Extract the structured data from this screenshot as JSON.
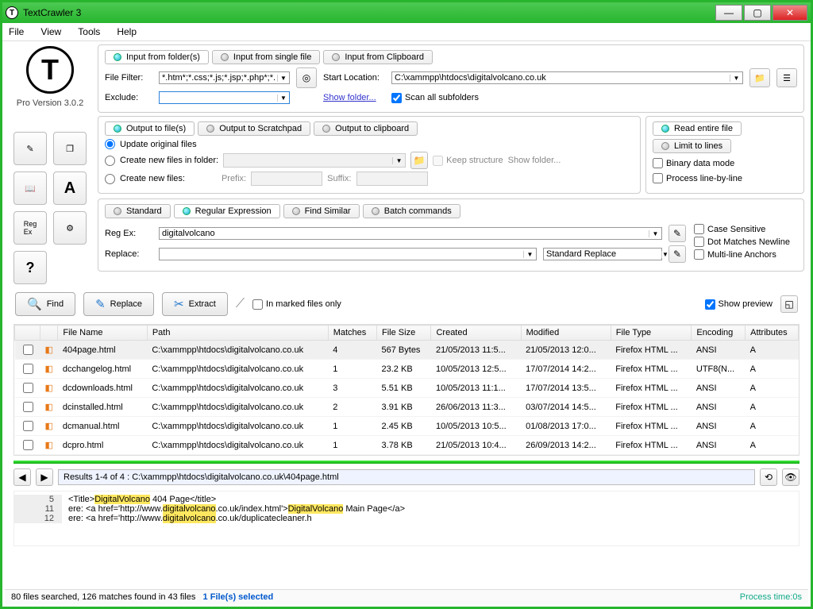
{
  "titlebar": {
    "title": "TextCrawler 3"
  },
  "menubar": {
    "file": "File",
    "view": "View",
    "tools": "Tools",
    "help": "Help"
  },
  "sidebar": {
    "version": "Pro Version 3.0.2",
    "regex": "Reg\nEx"
  },
  "input": {
    "tabs": {
      "folders": "Input from folder(s)",
      "single": "Input from single file",
      "clipboard": "Input from Clipboard"
    },
    "file_filter_label": "File Filter:",
    "file_filter_value": "*.htm*;*.css;*.js;*.jsp;*.php*;*.asp",
    "start_location_label": "Start Location:",
    "start_location_value": "C:\\xammpp\\htdocs\\digitalvolcano.co.uk",
    "exclude_label": "Exclude:",
    "exclude_value": "",
    "show_folder": "Show folder...",
    "scan_subfolders": "Scan all subfolders"
  },
  "output": {
    "tabs": {
      "files": "Output to file(s)",
      "scratch": "Output to Scratchpad",
      "clipboard": "Output to clipboard"
    },
    "update_original": "Update original files",
    "create_in_folder": "Create new files in folder:",
    "keep_structure": "Keep structure",
    "show_folder": "Show folder...",
    "create_new": "Create new files:",
    "prefix": "Prefix:",
    "suffix": "Suffix:"
  },
  "read": {
    "tabs": {
      "entire": "Read entire file",
      "limit": "Limit to lines"
    },
    "binary": "Binary data mode",
    "line": "Process line-by-line"
  },
  "search": {
    "tabs": {
      "standard": "Standard",
      "regex": "Regular Expression",
      "similar": "Find Similar",
      "batch": "Batch commands"
    },
    "regex_label": "Reg Ex:",
    "regex_value": "digitalvolcano",
    "replace_label": "Replace:",
    "replace_mode": "Standard Replace",
    "case_sensitive": "Case Sensitive",
    "dot_newline": "Dot Matches Newline",
    "multi_anchors": "Multi-line Anchors"
  },
  "actions": {
    "find": "Find",
    "replace": "Replace",
    "extract": "Extract",
    "marked": "In marked files only",
    "preview": "Show preview"
  },
  "table": {
    "headers": {
      "fname": "File Name",
      "path": "Path",
      "matches": "Matches",
      "fsize": "File Size",
      "created": "Created",
      "modified": "Modified",
      "ftype": "File Type",
      "enc": "Encoding",
      "attr": "Attributes"
    },
    "rows": [
      {
        "fname": "404page.html",
        "path": "C:\\xammpp\\htdocs\\digitalvolcano.co.uk",
        "matches": "4",
        "fsize": "567 Bytes",
        "created": "21/05/2013 11:5...",
        "modified": "21/05/2013 12:0...",
        "ftype": "Firefox HTML ...",
        "enc": "ANSI",
        "attr": "A"
      },
      {
        "fname": "dcchangelog.html",
        "path": "C:\\xammpp\\htdocs\\digitalvolcano.co.uk",
        "matches": "1",
        "fsize": "23.2 KB",
        "created": "10/05/2013 12:5...",
        "modified": "17/07/2014 14:2...",
        "ftype": "Firefox HTML ...",
        "enc": "UTF8(N...",
        "attr": "A"
      },
      {
        "fname": "dcdownloads.html",
        "path": "C:\\xammpp\\htdocs\\digitalvolcano.co.uk",
        "matches": "3",
        "fsize": "5.51 KB",
        "created": "10/05/2013 11:1...",
        "modified": "17/07/2014 13:5...",
        "ftype": "Firefox HTML ...",
        "enc": "ANSI",
        "attr": "A"
      },
      {
        "fname": "dcinstalled.html",
        "path": "C:\\xammpp\\htdocs\\digitalvolcano.co.uk",
        "matches": "2",
        "fsize": "3.91 KB",
        "created": "26/06/2013 11:3...",
        "modified": "03/07/2014 14:5...",
        "ftype": "Firefox HTML ...",
        "enc": "ANSI",
        "attr": "A"
      },
      {
        "fname": "dcmanual.html",
        "path": "C:\\xammpp\\htdocs\\digitalvolcano.co.uk",
        "matches": "1",
        "fsize": "2.45 KB",
        "created": "10/05/2013 10:5...",
        "modified": "01/08/2013 17:0...",
        "ftype": "Firefox HTML ...",
        "enc": "ANSI",
        "attr": "A"
      },
      {
        "fname": "dcpro.html",
        "path": "C:\\xammpp\\htdocs\\digitalvolcano.co.uk",
        "matches": "1",
        "fsize": "3.78 KB",
        "created": "21/05/2013 10:4...",
        "modified": "26/09/2013 14:2...",
        "ftype": "Firefox HTML ...",
        "enc": "ANSI",
        "attr": "A"
      }
    ]
  },
  "results": {
    "header": "Results 1-4 of 4 : C:\\xammpp\\htdocs\\digitalvolcano.co.uk\\404page.html",
    "lines": [
      {
        "n": "5",
        "pre": "<Title>",
        "hl": "DigitalVolcano",
        "post": " 404 Page</title>"
      },
      {
        "n": "11",
        "pre": "ere: <a href='http://www.",
        "hl": "digitalvolcano",
        "mid": ".co.uk/index.html'>",
        "hl2": "DigitalVolcano",
        "post": " Main Page</a>"
      },
      {
        "n": "12",
        "pre": "ere: <a href='http://www.",
        "hl": "digitalvolcano",
        "post": ".co.uk/duplicatecleaner.h"
      }
    ]
  },
  "status": {
    "left_a": "80 files searched, 126 matches found in 43 files",
    "left_b": "1 File(s) selected",
    "right": "Process time:0s"
  }
}
